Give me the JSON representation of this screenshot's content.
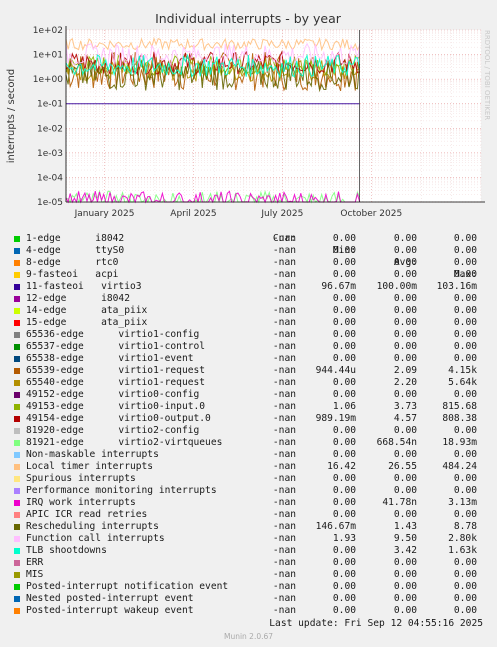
{
  "chart_data": {
    "type": "line",
    "title": "Individual interrupts - by year",
    "ylabel": "interrupts / second",
    "yscale": "log",
    "ylim": [
      1e-05,
      100
    ],
    "y_ticks": [
      "1e+02",
      "1e+01",
      "1e+00",
      "1e-01",
      "1e-02",
      "1e-03",
      "1e-04",
      "1e-05"
    ],
    "x_ticks": [
      "January 2025",
      "April 2025",
      "July 2025",
      "October 2025"
    ],
    "grid": true,
    "watermark": "RRDTOOL / TOBI OETIKER",
    "columns": [
      "Cur:",
      "Min:",
      "Avg:",
      "Max:"
    ],
    "series": [
      {
        "name": "1-edge      i8042",
        "color": "#00cc00",
        "cur": "-nan",
        "min": "0.00",
        "avg": "0.00",
        "max": "0.00"
      },
      {
        "name": "4-edge      ttyS0",
        "color": "#0066b3",
        "cur": "-nan",
        "min": "0.00",
        "avg": "0.00",
        "max": "0.00"
      },
      {
        "name": "8-edge      rtc0",
        "color": "#ff8000",
        "cur": "-nan",
        "min": "0.00",
        "avg": "0.00",
        "max": "0.00"
      },
      {
        "name": "9-fasteoi   acpi",
        "color": "#ffcc00",
        "cur": "-nan",
        "min": "0.00",
        "avg": "0.00",
        "max": "0.00"
      },
      {
        "name": "11-fasteoi   virtio3",
        "color": "#330099",
        "cur": "-nan",
        "min": "96.67m",
        "avg": "100.00m",
        "max": "103.16m"
      },
      {
        "name": "12-edge      i8042",
        "color": "#990099",
        "cur": "-nan",
        "min": "0.00",
        "avg": "0.00",
        "max": "0.00"
      },
      {
        "name": "14-edge      ata_piix",
        "color": "#ccff00",
        "cur": "-nan",
        "min": "0.00",
        "avg": "0.00",
        "max": "0.00"
      },
      {
        "name": "15-edge      ata_piix",
        "color": "#ff0000",
        "cur": "-nan",
        "min": "0.00",
        "avg": "0.00",
        "max": "0.00"
      },
      {
        "name": "65536-edge      virtio1-config",
        "color": "#808080",
        "cur": "-nan",
        "min": "0.00",
        "avg": "0.00",
        "max": "0.00"
      },
      {
        "name": "65537-edge      virtio1-control",
        "color": "#008f00",
        "cur": "-nan",
        "min": "0.00",
        "avg": "0.00",
        "max": "0.00"
      },
      {
        "name": "65538-edge      virtio1-event",
        "color": "#00487d",
        "cur": "-nan",
        "min": "0.00",
        "avg": "0.00",
        "max": "0.00"
      },
      {
        "name": "65539-edge      virtio1-request",
        "color": "#b35a00",
        "cur": "-nan",
        "min": "944.44u",
        "avg": "2.09",
        "max": "4.15k"
      },
      {
        "name": "65540-edge      virtio1-request",
        "color": "#b38f00",
        "cur": "-nan",
        "min": "0.00",
        "avg": "2.20",
        "max": "5.64k"
      },
      {
        "name": "49152-edge      virtio0-config",
        "color": "#6b006b",
        "cur": "-nan",
        "min": "0.00",
        "avg": "0.00",
        "max": "0.00"
      },
      {
        "name": "49153-edge      virtio0-input.0",
        "color": "#8fb300",
        "cur": "-nan",
        "min": "1.06",
        "avg": "3.73",
        "max": "815.68"
      },
      {
        "name": "49154-edge      virtio0-output.0",
        "color": "#b30000",
        "cur": "-nan",
        "min": "989.19m",
        "avg": "4.57",
        "max": "808.38"
      },
      {
        "name": "81920-edge      virtio2-config",
        "color": "#bebebe",
        "cur": "-nan",
        "min": "0.00",
        "avg": "0.00",
        "max": "0.00"
      },
      {
        "name": "81921-edge      virtio2-virtqueues",
        "color": "#80ff80",
        "cur": "-nan",
        "min": "0.00",
        "avg": "668.54n",
        "max": "18.93m"
      },
      {
        "name": "Non-maskable interrupts",
        "color": "#80c9ff",
        "cur": "-nan",
        "min": "0.00",
        "avg": "0.00",
        "max": "0.00"
      },
      {
        "name": "Local timer interrupts",
        "color": "#ffc080",
        "cur": "-nan",
        "min": "16.42",
        "avg": "26.55",
        "max": "484.24"
      },
      {
        "name": "Spurious interrupts",
        "color": "#ffe680",
        "cur": "-nan",
        "min": "0.00",
        "avg": "0.00",
        "max": "0.00"
      },
      {
        "name": "Performance monitoring interrupts",
        "color": "#aa80ff",
        "cur": "-nan",
        "min": "0.00",
        "avg": "0.00",
        "max": "0.00"
      },
      {
        "name": "IRQ work interrupts",
        "color": "#ee00cc",
        "cur": "-nan",
        "min": "0.00",
        "avg": "41.78n",
        "max": "3.13m"
      },
      {
        "name": "APIC ICR read retries",
        "color": "#ff8080",
        "cur": "-nan",
        "min": "0.00",
        "avg": "0.00",
        "max": "0.00"
      },
      {
        "name": "Rescheduling interrupts",
        "color": "#666600",
        "cur": "-nan",
        "min": "146.67m",
        "avg": "1.43",
        "max": "8.78"
      },
      {
        "name": "Function call interrupts",
        "color": "#ffbfff",
        "cur": "-nan",
        "min": "1.93",
        "avg": "9.50",
        "max": "2.80k"
      },
      {
        "name": "TLB shootdowns",
        "color": "#00ffcc",
        "cur": "-nan",
        "min": "0.00",
        "avg": "3.42",
        "max": "1.63k"
      },
      {
        "name": "ERR",
        "color": "#cc6699",
        "cur": "-nan",
        "min": "0.00",
        "avg": "0.00",
        "max": "0.00"
      },
      {
        "name": "MIS",
        "color": "#999900",
        "cur": "-nan",
        "min": "0.00",
        "avg": "0.00",
        "max": "0.00"
      },
      {
        "name": "Posted-interrupt notification event",
        "color": "#00cc00",
        "cur": "-nan",
        "min": "0.00",
        "avg": "0.00",
        "max": "0.00"
      },
      {
        "name": "Nested posted-interrupt event",
        "color": "#0066b3",
        "cur": "-nan",
        "min": "0.00",
        "avg": "0.00",
        "max": "0.00"
      },
      {
        "name": "Posted-interrupt wakeup event",
        "color": "#ff8000",
        "cur": "-nan",
        "min": "0.00",
        "avg": "0.00",
        "max": "0.00"
      }
    ]
  },
  "last_update": "Last update: Fri Sep 12 04:55:16 2025",
  "footer": "Munin 2.0.67"
}
